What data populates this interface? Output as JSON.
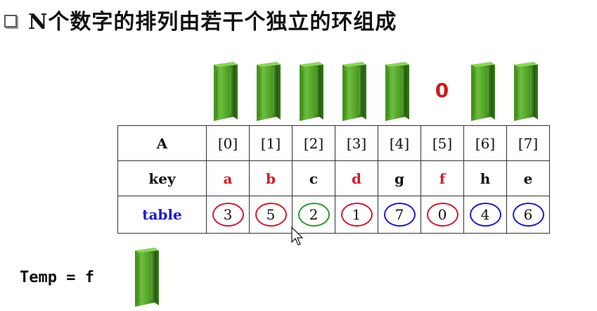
{
  "heading": "N个数字的排列由若干个独立的环组成",
  "colors": {
    "red": "#d01c2a",
    "green": "#2a9a2a",
    "blue": "#1b1bc8",
    "book_green": "#5aa52f"
  },
  "slots": [
    {
      "type": "book",
      "icon": "book-icon"
    },
    {
      "type": "book",
      "icon": "book-icon"
    },
    {
      "type": "book",
      "icon": "book-icon"
    },
    {
      "type": "book",
      "icon": "book-icon"
    },
    {
      "type": "book",
      "icon": "book-icon"
    },
    {
      "type": "text",
      "text": "0"
    },
    {
      "type": "book",
      "icon": "book-icon"
    },
    {
      "type": "book",
      "icon": "book-icon"
    }
  ],
  "table": {
    "row_labels": [
      "A",
      "key",
      "table"
    ],
    "indices": [
      "[0]",
      "[1]",
      "[2]",
      "[3]",
      "[4]",
      "[5]",
      "[6]",
      "[7]"
    ],
    "keys": [
      {
        "text": "a",
        "color": "red"
      },
      {
        "text": "b",
        "color": "red"
      },
      {
        "text": "c",
        "color": "black"
      },
      {
        "text": "d",
        "color": "red"
      },
      {
        "text": "g",
        "color": "black"
      },
      {
        "text": "f",
        "color": "red"
      },
      {
        "text": "h",
        "color": "black"
      },
      {
        "text": "e",
        "color": "black"
      }
    ],
    "values": [
      {
        "text": "3",
        "ring": "red"
      },
      {
        "text": "5",
        "ring": "red"
      },
      {
        "text": "2",
        "ring": "green"
      },
      {
        "text": "1",
        "ring": "red"
      },
      {
        "text": "7",
        "ring": "blue"
      },
      {
        "text": "0",
        "ring": "red"
      },
      {
        "text": "4",
        "ring": "blue"
      },
      {
        "text": "6",
        "ring": "blue"
      }
    ]
  },
  "temp": {
    "label": "Temp = f",
    "icon": "book-icon"
  }
}
